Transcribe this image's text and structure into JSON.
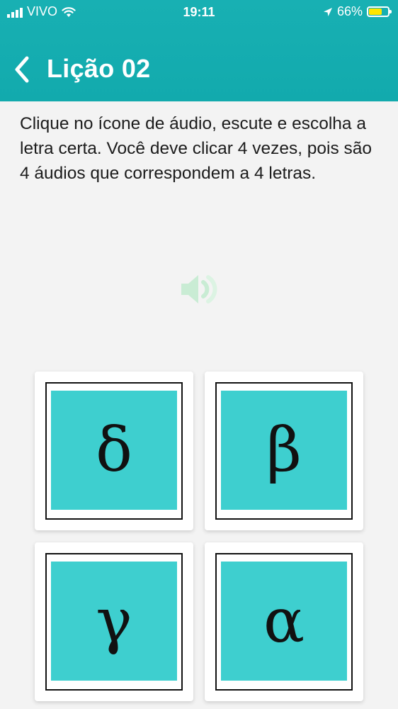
{
  "status_bar": {
    "carrier": "VIVO",
    "time": "19:11",
    "battery_percent": "66%",
    "battery_level": 0.66,
    "icons": [
      "signal-icon",
      "wifi-icon",
      "location-arrow-icon",
      "battery-icon"
    ]
  },
  "header": {
    "back_icon": "chevron-left-icon",
    "title": "Lição 02",
    "color": "#14aeb0"
  },
  "instructions": "Clique no ícone de áudio, escute e escolha a letra certa. Você deve clicar 4 vezes, pois são 4 áudios que correspondem a 4 letras.",
  "audio": {
    "icon": "speaker-icon",
    "color": "#c9ecd4"
  },
  "cards": [
    {
      "letter": "δ"
    },
    {
      "letter": "β"
    },
    {
      "letter": "γ"
    },
    {
      "letter": "α"
    }
  ],
  "tile_color": "#3ecfcf"
}
